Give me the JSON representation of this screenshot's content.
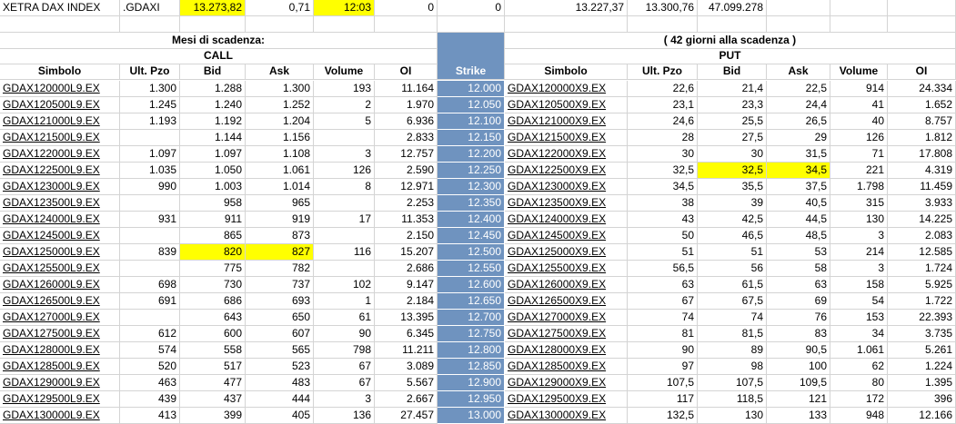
{
  "header": {
    "name": "XETRA DAX INDEX",
    "ticker": ".GDAXI",
    "last": "13.273,82",
    "change": "0,71",
    "time": "12:03",
    "v1": "0",
    "v2": "0",
    "low": "13.227,37",
    "high": "13.300,76",
    "volume": "47.099.278",
    "highlight_color": "#ffff00"
  },
  "labels": {
    "expiry": "Mesi di scadenza:",
    "days": "( 42 giorni alla scadenza )",
    "call": "CALL",
    "put": "PUT"
  },
  "columns": {
    "call": [
      "Simbolo",
      "Ult. Pzo",
      "Bid",
      "Ask",
      "Volume",
      "OI"
    ],
    "strike": "Strike",
    "put": [
      "Simbolo",
      "Ult. Pzo",
      "Bid",
      "Ask",
      "Volume",
      "OI"
    ]
  },
  "strike_color": "#6f93bf",
  "rows": [
    {
      "cs": "GDAX120000L9.EX",
      "cl": "1.300",
      "cb": "1.288",
      "ca": "1.300",
      "cv": "193",
      "co": "11.164",
      "k": "12.000",
      "ps": "GDAX120000X9.EX",
      "pl": "22,6",
      "pb": "21,4",
      "pa": "22,5",
      "pv": "914",
      "po": "24.334"
    },
    {
      "cs": "GDAX120500L9.EX",
      "cl": "1.245",
      "cb": "1.240",
      "ca": "1.252",
      "cv": "2",
      "co": "1.970",
      "k": "12.050",
      "ps": "GDAX120500X9.EX",
      "pl": "23,1",
      "pb": "23,3",
      "pa": "24,4",
      "pv": "41",
      "po": "1.652"
    },
    {
      "cs": "GDAX121000L9.EX",
      "cl": "1.193",
      "cb": "1.192",
      "ca": "1.204",
      "cv": "5",
      "co": "6.936",
      "k": "12.100",
      "ps": "GDAX121000X9.EX",
      "pl": "24,6",
      "pb": "25,5",
      "pa": "26,5",
      "pv": "40",
      "po": "8.757"
    },
    {
      "cs": "GDAX121500L9.EX",
      "cl": "",
      "cb": "1.144",
      "ca": "1.156",
      "cv": "",
      "co": "2.833",
      "k": "12.150",
      "ps": "GDAX121500X9.EX",
      "pl": "28",
      "pb": "27,5",
      "pa": "29",
      "pv": "126",
      "po": "1.812"
    },
    {
      "cs": "GDAX122000L9.EX",
      "cl": "1.097",
      "cb": "1.097",
      "ca": "1.108",
      "cv": "3",
      "co": "12.757",
      "k": "12.200",
      "ps": "GDAX122000X9.EX",
      "pl": "30",
      "pb": "30",
      "pa": "31,5",
      "pv": "71",
      "po": "17.808"
    },
    {
      "cs": "GDAX122500L9.EX",
      "cl": "1.035",
      "cb": "1.050",
      "ca": "1.061",
      "cv": "126",
      "co": "2.590",
      "k": "12.250",
      "ps": "GDAX122500X9.EX",
      "pl": "32,5",
      "pb": "32,5",
      "pa": "34,5",
      "pv": "221",
      "po": "4.319",
      "hlp": true
    },
    {
      "cs": "GDAX123000L9.EX",
      "cl": "990",
      "cb": "1.003",
      "ca": "1.014",
      "cv": "8",
      "co": "12.971",
      "k": "12.300",
      "ps": "GDAX123000X9.EX",
      "pl": "34,5",
      "pb": "35,5",
      "pa": "37,5",
      "pv": "1.798",
      "po": "11.459"
    },
    {
      "cs": "GDAX123500L9.EX",
      "cl": "",
      "cb": "958",
      "ca": "965",
      "cv": "",
      "co": "2.253",
      "k": "12.350",
      "ps": "GDAX123500X9.EX",
      "pl": "38",
      "pb": "39",
      "pa": "40,5",
      "pv": "315",
      "po": "3.933"
    },
    {
      "cs": "GDAX124000L9.EX",
      "cl": "931",
      "cb": "911",
      "ca": "919",
      "cv": "17",
      "co": "11.353",
      "k": "12.400",
      "ps": "GDAX124000X9.EX",
      "pl": "43",
      "pb": "42,5",
      "pa": "44,5",
      "pv": "130",
      "po": "14.225"
    },
    {
      "cs": "GDAX124500L9.EX",
      "cl": "",
      "cb": "865",
      "ca": "873",
      "cv": "",
      "co": "2.150",
      "k": "12.450",
      "ps": "GDAX124500X9.EX",
      "pl": "50",
      "pb": "46,5",
      "pa": "48,5",
      "pv": "3",
      "po": "2.083"
    },
    {
      "cs": "GDAX125000L9.EX",
      "cl": "839",
      "cb": "820",
      "ca": "827",
      "cv": "116",
      "co": "15.207",
      "k": "12.500",
      "ps": "GDAX125000X9.EX",
      "pl": "51",
      "pb": "51",
      "pa": "53",
      "pv": "214",
      "po": "12.585",
      "hlc": true
    },
    {
      "cs": "GDAX125500L9.EX",
      "cl": "",
      "cb": "775",
      "ca": "782",
      "cv": "",
      "co": "2.686",
      "k": "12.550",
      "ps": "GDAX125500X9.EX",
      "pl": "56,5",
      "pb": "56",
      "pa": "58",
      "pv": "3",
      "po": "1.724"
    },
    {
      "cs": "GDAX126000L9.EX",
      "cl": "698",
      "cb": "730",
      "ca": "737",
      "cv": "102",
      "co": "9.147",
      "k": "12.600",
      "ps": "GDAX126000X9.EX",
      "pl": "63",
      "pb": "61,5",
      "pa": "63",
      "pv": "158",
      "po": "5.925"
    },
    {
      "cs": "GDAX126500L9.EX",
      "cl": "691",
      "cb": "686",
      "ca": "693",
      "cv": "1",
      "co": "2.184",
      "k": "12.650",
      "ps": "GDAX126500X9.EX",
      "pl": "67",
      "pb": "67,5",
      "pa": "69",
      "pv": "54",
      "po": "1.722"
    },
    {
      "cs": "GDAX127000L9.EX",
      "cl": "",
      "cb": "643",
      "ca": "650",
      "cv": "61",
      "co": "13.395",
      "k": "12.700",
      "ps": "GDAX127000X9.EX",
      "pl": "74",
      "pb": "74",
      "pa": "76",
      "pv": "153",
      "po": "22.393"
    },
    {
      "cs": "GDAX127500L9.EX",
      "cl": "612",
      "cb": "600",
      "ca": "607",
      "cv": "90",
      "co": "6.345",
      "k": "12.750",
      "ps": "GDAX127500X9.EX",
      "pl": "81",
      "pb": "81,5",
      "pa": "83",
      "pv": "34",
      "po": "3.735"
    },
    {
      "cs": "GDAX128000L9.EX",
      "cl": "574",
      "cb": "558",
      "ca": "565",
      "cv": "798",
      "co": "11.211",
      "k": "12.800",
      "ps": "GDAX128000X9.EX",
      "pl": "90",
      "pb": "89",
      "pa": "90,5",
      "pv": "1.061",
      "po": "5.261"
    },
    {
      "cs": "GDAX128500L9.EX",
      "cl": "520",
      "cb": "517",
      "ca": "523",
      "cv": "67",
      "co": "3.089",
      "k": "12.850",
      "ps": "GDAX128500X9.EX",
      "pl": "97",
      "pb": "98",
      "pa": "100",
      "pv": "62",
      "po": "1.224"
    },
    {
      "cs": "GDAX129000L9.EX",
      "cl": "463",
      "cb": "477",
      "ca": "483",
      "cv": "67",
      "co": "5.567",
      "k": "12.900",
      "ps": "GDAX129000X9.EX",
      "pl": "107,5",
      "pb": "107,5",
      "pa": "109,5",
      "pv": "80",
      "po": "1.395"
    },
    {
      "cs": "GDAX129500L9.EX",
      "cl": "439",
      "cb": "437",
      "ca": "444",
      "cv": "3",
      "co": "2.667",
      "k": "12.950",
      "ps": "GDAX129500X9.EX",
      "pl": "117",
      "pb": "118,5",
      "pa": "121",
      "pv": "172",
      "po": "396"
    },
    {
      "cs": "GDAX130000L9.EX",
      "cl": "413",
      "cb": "399",
      "ca": "405",
      "cv": "136",
      "co": "27.457",
      "k": "13.000",
      "ps": "GDAX130000X9.EX",
      "pl": "132,5",
      "pb": "130",
      "pa": "133",
      "pv": "948",
      "po": "12.166"
    }
  ]
}
